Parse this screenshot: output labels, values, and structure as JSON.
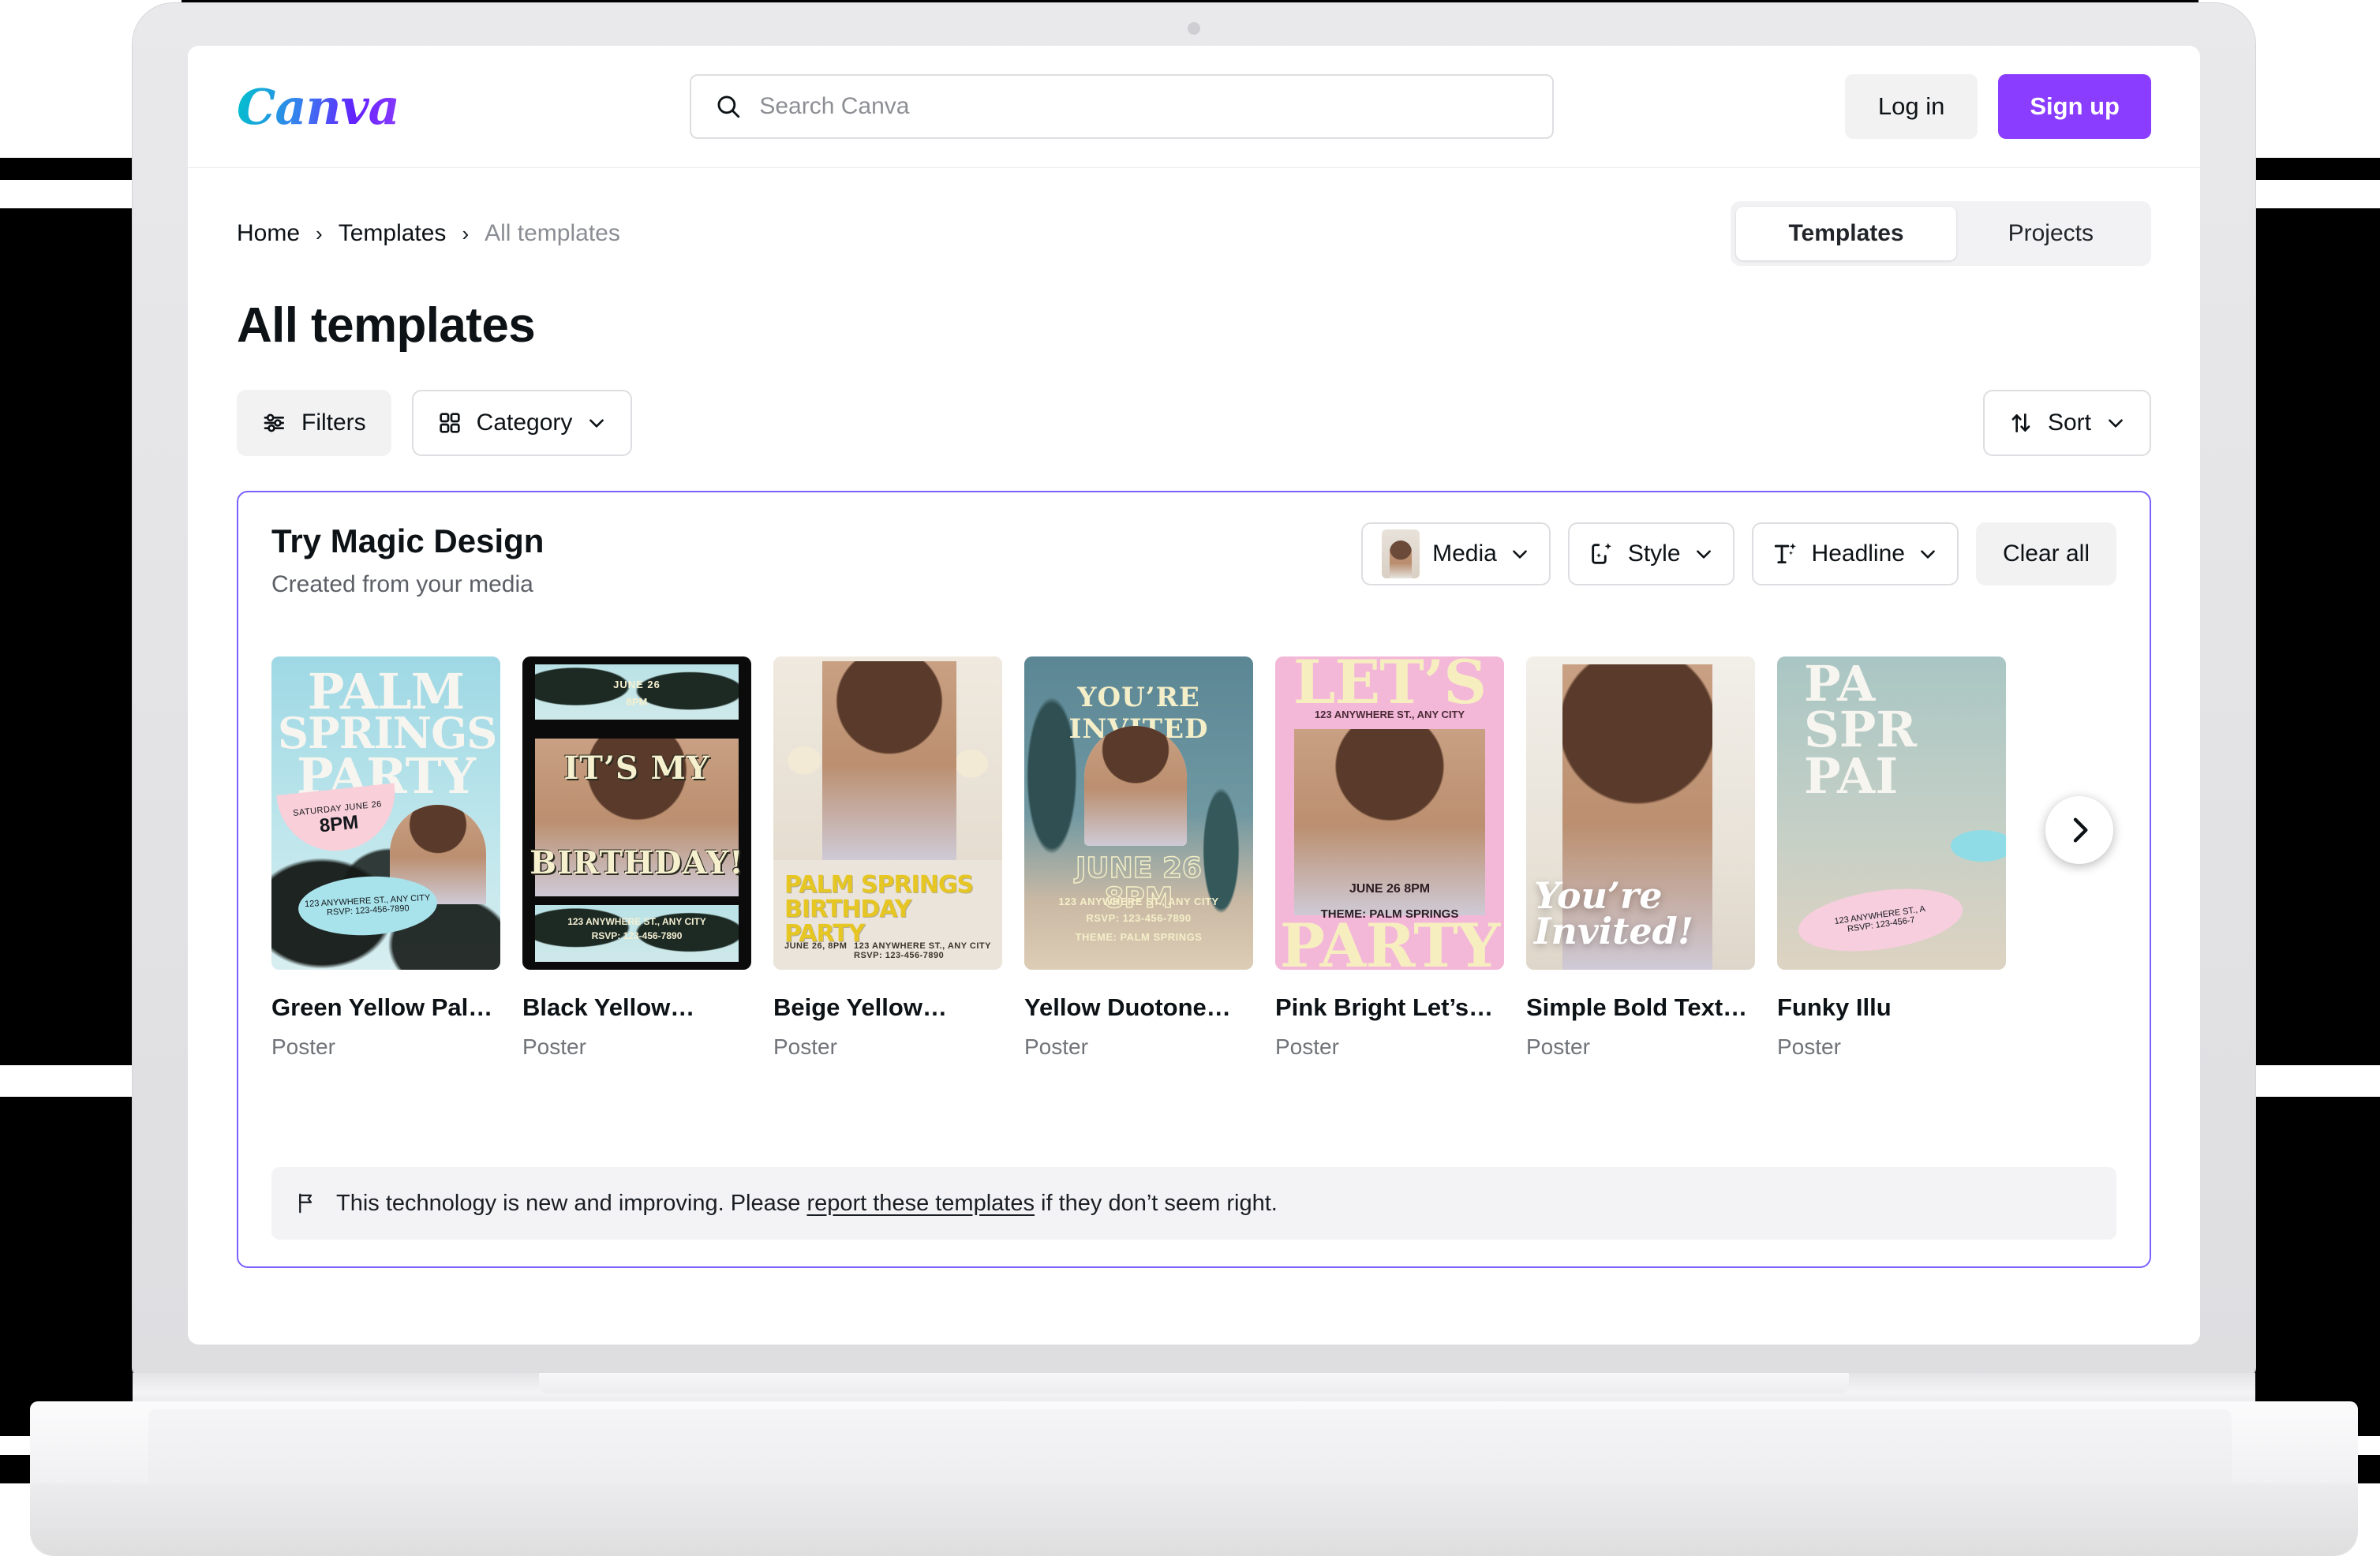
{
  "header": {
    "logo_text": "Canva",
    "search": {
      "placeholder": "Search Canva",
      "value": "",
      "icon": "search-icon"
    },
    "login_label": "Log in",
    "signup_label": "Sign up",
    "signup_color": "#8B3DFF"
  },
  "breadcrumb": {
    "items": [
      {
        "label": "Home",
        "current": false
      },
      {
        "label": "Templates",
        "current": false
      },
      {
        "label": "All templates",
        "current": true
      }
    ],
    "separator": "›"
  },
  "view_switch": {
    "tabs": [
      {
        "label": "Templates",
        "active": true
      },
      {
        "label": "Projects",
        "active": false
      }
    ]
  },
  "page_title": "All templates",
  "controls": {
    "filters_label": "Filters",
    "filters_icon": "sliders-icon",
    "category_label": "Category",
    "category_icon": "grid-icon",
    "sort_label": "Sort",
    "sort_icon": "sort-arrows-icon",
    "chevron": "∨"
  },
  "magic_design": {
    "title": "Try Magic Design",
    "subtitle": "Created from your media",
    "accent_color": "#7B61FF",
    "controls": [
      {
        "label": "Media",
        "icon": "media-thumbnail-icon",
        "has_chevron": true
      },
      {
        "label": "Style",
        "icon": "style-sparkle-icon",
        "has_chevron": true
      },
      {
        "label": "Headline",
        "icon": "headline-text-icon",
        "has_chevron": true
      }
    ],
    "clear_all_label": "Clear all",
    "next_icon": "chevron-right-icon",
    "notice": {
      "icon": "flag-icon",
      "before": "This technology is new and improving. Please ",
      "link": "report these templates",
      "after": " if they don’t seem right."
    },
    "templates": [
      {
        "title": "Green Yellow Pal…",
        "type": "Poster",
        "art": {
          "heading_lines": [
            "PALM",
            "SPRINGS",
            "PARTY"
          ],
          "badge_line1": "SATURDAY JUNE 26",
          "badge_line2": "8PM",
          "address": "123 ANYWHERE ST., ANY CITY",
          "rsvp": "RSVP: 123-456-7890"
        }
      },
      {
        "title": "Black Yellow…",
        "type": "Poster",
        "art": {
          "date": "JUNE 26",
          "time": "8PM",
          "heading_lines": [
            "IT’S MY",
            "BIRTHDAY!"
          ],
          "address": "123 ANYWHERE ST., ANY CITY",
          "rsvp": "RSVP: 123-456-7890"
        }
      },
      {
        "title": "Beige Yellow…",
        "type": "Poster",
        "art": {
          "heading_lines": [
            "PALM SPRINGS",
            "BIRTHDAY PARTY"
          ],
          "date": "JUNE 26, 8PM",
          "address": "123 ANYWHERE ST., ANY CITY",
          "rsvp": "RSVP: 123-456-7890"
        }
      },
      {
        "title": "Yellow Duotone…",
        "type": "Poster",
        "art": {
          "heading": "YOU’RE INVITED",
          "date": "JUNE 26",
          "time": "8PM",
          "theme": "THEME: PALM SPRINGS",
          "address": "123 ANYWHERE ST., ANY CITY",
          "rsvp": "RSVP: 123-456-7890"
        }
      },
      {
        "title": "Pink Bright Let’s…",
        "type": "Poster",
        "art": {
          "top_word": "LET’S",
          "bottom_word": "PARTY",
          "address": "123 ANYWHERE ST., ANY CITY",
          "date": "JUNE 26   8PM",
          "theme": "THEME: PALM SPRINGS"
        }
      },
      {
        "title": "Simple Bold Text…",
        "type": "Poster",
        "art": {
          "heading_lines": [
            "You’re",
            "Invited!"
          ]
        }
      },
      {
        "title": "Funky Illu",
        "type": "Poster",
        "art": {
          "heading_lines": [
            "PA",
            "SPR",
            "PAI"
          ],
          "address": "123 ANYWHERE ST., A",
          "rsvp": "RSVP: 123-456-7"
        }
      }
    ]
  }
}
